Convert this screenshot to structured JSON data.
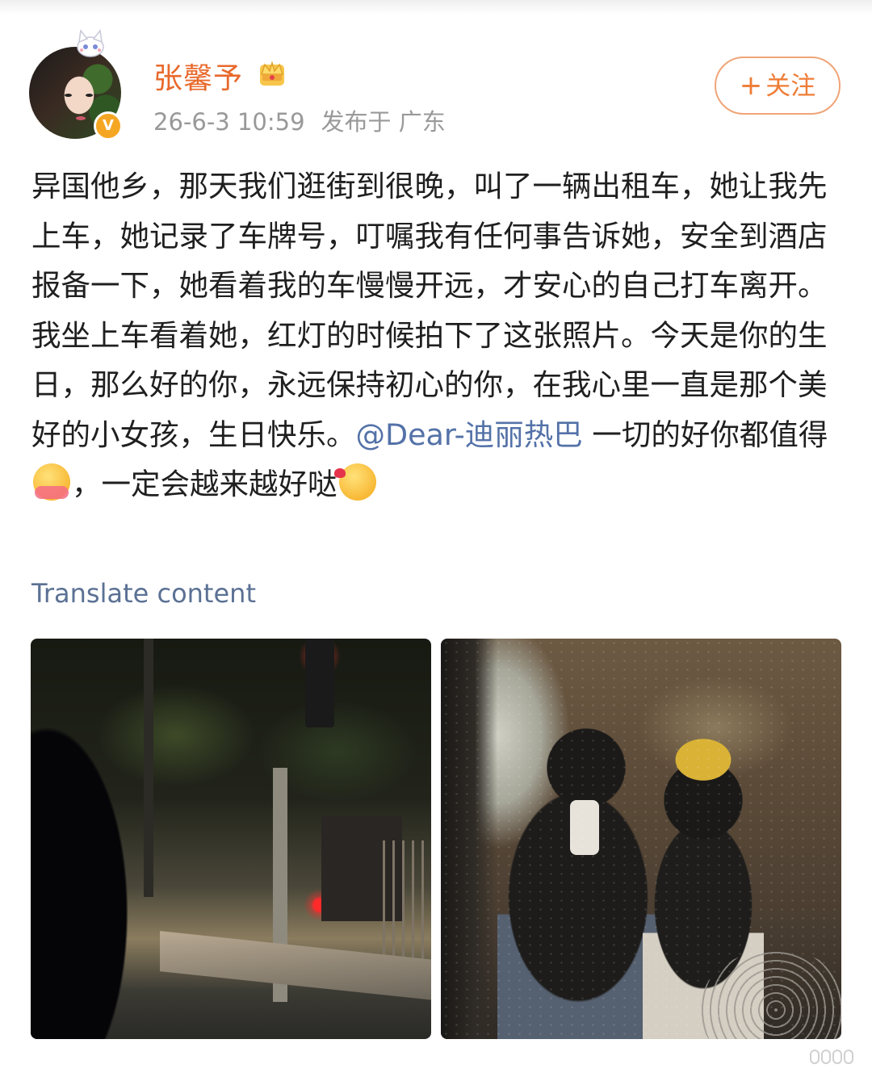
{
  "post": {
    "author": {
      "name": "张馨予",
      "avatar_icon": "avatar-photo",
      "badge_icon": "crown-icon",
      "verified_icon": "verified-v-icon",
      "verified_label": "V"
    },
    "timestamp": "26-6-3 10:59",
    "location": "发布于 广东",
    "follow_button": {
      "plus": "+",
      "label": "关注"
    },
    "content": {
      "text_part1": "异国他乡，那天我们逛街到很晚，叫了一辆出租车，她让我先上车，她记录了车牌号，叮嘱我有任何事告诉她，安全到酒店报备一下，她看着我的车慢慢开远，才安心的自己打车离开。我坐上车看着她，红灯的时候拍下了这张照片。今天是你的生日，那么好的你，永远保持初心的你，在我心里一直是那个美好的小女孩，生日快乐。",
      "mention": "@Dear-迪丽热巴",
      "text_part2": " 一切的好你都值得",
      "emoji1": "hug-emoji",
      "text_part3": "，一定会越来越好哒",
      "emoji2": "kiss-emoji"
    },
    "translate_label": "Translate content",
    "images": [
      {
        "name": "night-street-photo"
      },
      {
        "name": "mirror-selfie-photo"
      }
    ]
  },
  "colors": {
    "username": "#e8692c",
    "follow_border": "#f0a477",
    "follow_text": "#ef7c36",
    "mention": "#5472a8",
    "meta": "#999999",
    "translate": "#5b7194"
  }
}
